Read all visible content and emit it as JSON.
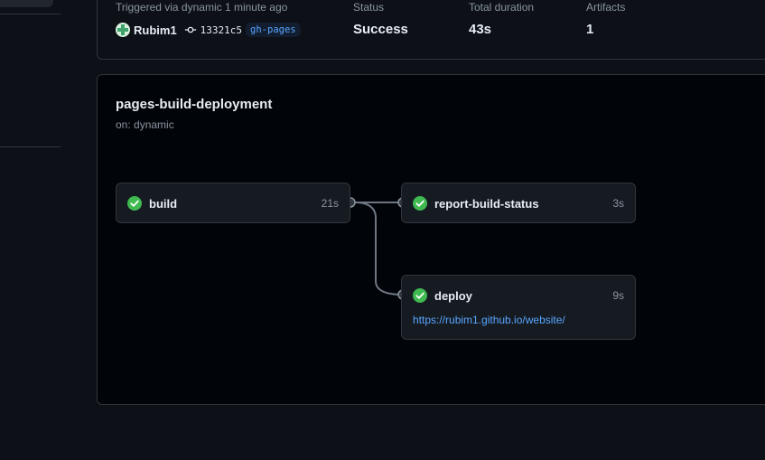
{
  "summary": {
    "trigger_label": "Triggered via dynamic 1 minute ago",
    "actor": "Rubim1",
    "commit": "13321c5",
    "branch": "gh-pages",
    "status_label": "Status",
    "status_value": "Success",
    "duration_label": "Total duration",
    "duration_value": "43s",
    "artifacts_label": "Artifacts",
    "artifacts_value": "1"
  },
  "workflow": {
    "name": "pages-build-deployment",
    "trigger": "on: dynamic",
    "jobs": [
      {
        "name": "build",
        "duration": "21s",
        "status": "success"
      },
      {
        "name": "report-build-status",
        "duration": "3s",
        "status": "success"
      },
      {
        "name": "deploy",
        "duration": "9s",
        "status": "success",
        "link": "https://rubim1.github.io/website/"
      }
    ]
  },
  "colors": {
    "success": "#3fb950",
    "link": "#58a6ff",
    "border": "#30363d"
  },
  "icons": {
    "avatar": "avatar-icon",
    "commit": "git-commit-icon",
    "job_status": "check-circle-icon"
  }
}
